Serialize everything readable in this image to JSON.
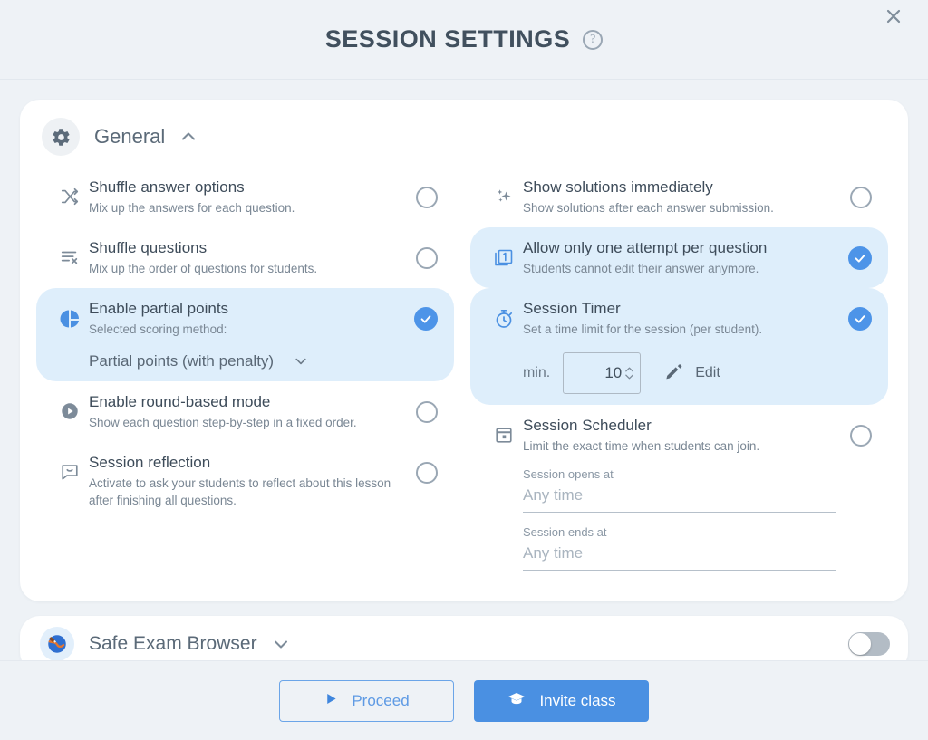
{
  "header": {
    "title": "Session Settings",
    "help_icon": "question-mark-icon",
    "close_icon": "close-icon"
  },
  "section": {
    "icon": "gear-icon",
    "title": "General",
    "collapse_icon": "chevron-up-icon"
  },
  "settings": {
    "left": [
      {
        "icon": "shuffle-icon",
        "title": "Shuffle answer options",
        "desc": "Mix up the answers for each question.",
        "enabled": false
      },
      {
        "icon": "shuffle-list-icon",
        "title": "Shuffle questions",
        "desc": "Mix up the order of questions for students.",
        "enabled": false
      },
      {
        "icon": "pie-chart-icon",
        "title": "Enable partial points",
        "desc": "Selected scoring method:",
        "enabled": true,
        "select": {
          "value": "Partial points (with penalty)",
          "caret_icon": "chevron-down-icon"
        }
      },
      {
        "icon": "play-circle-icon",
        "title": "Enable round-based mode",
        "desc": "Show each question step-by-step in a fixed order.",
        "enabled": false
      },
      {
        "icon": "speech-bubble-icon",
        "title": "Session reflection",
        "desc": "Activate to ask your students to reflect about this lesson after finishing all questions.",
        "enabled": false
      }
    ],
    "right": [
      {
        "icon": "sparkles-icon",
        "title": "Show solutions immediately",
        "desc": "Show solutions after each answer submission.",
        "enabled": false
      },
      {
        "icon": "one-attempt-icon",
        "title": "Allow only one attempt per question",
        "desc": "Students cannot edit their answer anymore.",
        "enabled": true
      },
      {
        "icon": "stopwatch-icon",
        "title": "Session Timer",
        "desc": "Set a time limit for the session (per student).",
        "enabled": true,
        "timer": {
          "unit_label": "min.",
          "value": "10",
          "edit_label": "Edit",
          "edit_icon": "pencil-icon"
        }
      },
      {
        "icon": "calendar-icon",
        "title": "Session Scheduler",
        "desc": "Limit the exact time when students can join.",
        "enabled": false,
        "fields": [
          {
            "label": "Session opens at",
            "placeholder": "Any time",
            "value": ""
          },
          {
            "label": "Session ends at",
            "placeholder": "Any time",
            "value": ""
          }
        ]
      }
    ]
  },
  "safe_exam_browser": {
    "icon": "seb-logo-icon",
    "title": "Safe Exam Browser",
    "expand_icon": "chevron-down-icon",
    "enabled": false
  },
  "footer": {
    "proceed": {
      "label": "Proceed",
      "icon": "play-icon"
    },
    "invite": {
      "label": "Invite class",
      "icon": "graduation-cap-icon"
    }
  },
  "colors": {
    "accent": "#4a90e2",
    "active_row_bg": "#deeefb",
    "page_bg": "#eef2f6",
    "card_bg": "#ffffff",
    "muted_text": "#7a8794",
    "title_text": "#3e4c5a",
    "toggle_off": "#b3bcc5"
  }
}
